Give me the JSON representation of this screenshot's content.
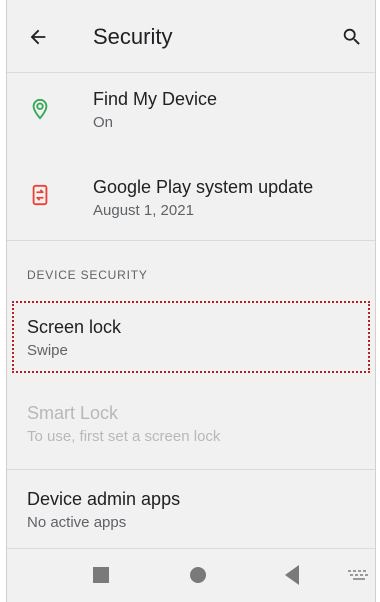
{
  "header": {
    "title": "Security"
  },
  "items": {
    "find_my_device": {
      "title": "Find My Device",
      "subtitle": "On"
    },
    "play_update": {
      "title": "Google Play system update",
      "subtitle": "August 1, 2021"
    },
    "section": {
      "label": "DEVICE SECURITY"
    },
    "screen_lock": {
      "title": "Screen lock",
      "subtitle": "Swipe"
    },
    "smart_lock": {
      "title": "Smart Lock",
      "subtitle": "To use, first set a screen lock"
    },
    "device_admin": {
      "title": "Device admin apps",
      "subtitle": "No active apps"
    }
  },
  "colors": {
    "find_icon": "#34a853",
    "update_icon": "#ea4335",
    "highlight_border": "#b22222"
  },
  "icons": {
    "back": "back-arrow-icon",
    "search": "search-icon",
    "find": "location-pin-icon",
    "update": "system-update-icon",
    "nav_recent": "recent-apps-icon",
    "nav_home": "home-icon",
    "nav_back": "back-triangle-icon",
    "nav_keyboard": "keyboard-icon"
  }
}
